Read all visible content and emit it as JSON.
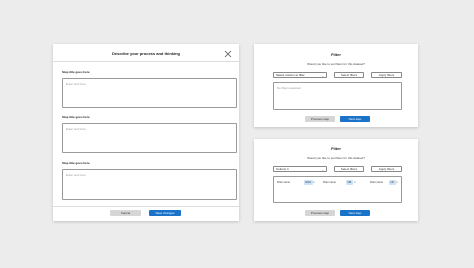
{
  "describe": {
    "title": "Describe your process and thinking",
    "steps": [
      {
        "label": "Step title goes here",
        "placeholder": "Enter text here"
      },
      {
        "label": "Step title goes here",
        "placeholder": "Enter text here"
      },
      {
        "label": "Step title goes here",
        "placeholder": "Enter text here"
      }
    ],
    "cancel_label": "Cancel",
    "save_label": "Save changes"
  },
  "filter_empty": {
    "title": "Filter",
    "subtitle": "Would you like to set filters for this dataset?",
    "select_value": "Select column to filter",
    "select_filters_label": "Select filters",
    "apply_filters_label": "Apply filters",
    "empty_text": "No filters selected",
    "previous_label": "Previous step",
    "next_label": "Next step"
  },
  "filter_filled": {
    "title": "Filter",
    "subtitle": "Would you like to set filters for this dataset?",
    "select_value": "Column 1",
    "select_filters_label": "Select filters",
    "apply_filters_label": "Apply filters",
    "filters": [
      {
        "name": "Filter name",
        "value": "ENG"
      },
      {
        "name": "Filter name",
        "value": "GB"
      },
      {
        "name": "Filter name",
        "value": "UK"
      }
    ],
    "previous_label": "Previous step",
    "next_label": "Next step"
  },
  "colors": {
    "accent": "#1a73c8",
    "chip": "#cfe3f5",
    "background": "#ececec"
  },
  "icons": {
    "close": "close-icon",
    "dropdown": "chevron-down-icon",
    "remove": "remove-chip-icon"
  }
}
